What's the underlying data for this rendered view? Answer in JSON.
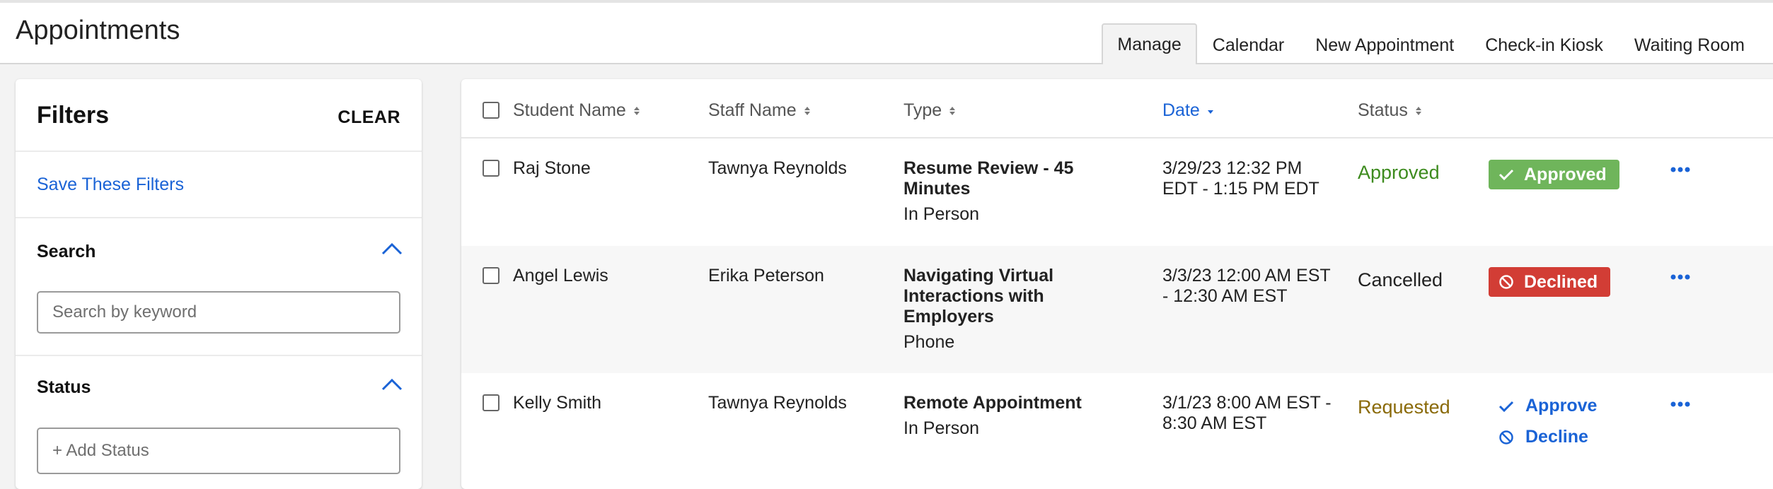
{
  "header": {
    "title": "Appointments",
    "tabs": [
      {
        "label": "Manage",
        "active": true
      },
      {
        "label": "Calendar"
      },
      {
        "label": "New Appointment"
      },
      {
        "label": "Check-in Kiosk"
      },
      {
        "label": "Waiting Room"
      }
    ]
  },
  "filters": {
    "title": "Filters",
    "clear_label": "CLEAR",
    "save_label": "Save These Filters",
    "search": {
      "title": "Search",
      "placeholder": "Search by keyword"
    },
    "status": {
      "title": "Status",
      "placeholder": "+ Add Status"
    }
  },
  "table": {
    "columns": {
      "student": "Student Name",
      "staff": "Staff Name",
      "type": "Type",
      "date": "Date",
      "status": "Status"
    },
    "sorted_column": "date",
    "rows": [
      {
        "student": "Raj Stone",
        "staff": "Tawnya Reynolds",
        "type_title": "Resume Review - 45 Minutes",
        "type_sub": "In Person",
        "date": "3/29/23 12:32 PM EDT - 1:15 PM EDT",
        "status": "Approved",
        "badge": "Approved"
      },
      {
        "student": "Angel Lewis",
        "staff": "Erika Peterson",
        "type_title": "Navigating Virtual Interactions with Employers",
        "type_sub": "Phone",
        "date": "3/3/23 12:00 AM EST - 12:30 AM EST",
        "status": "Cancelled",
        "badge": "Declined"
      },
      {
        "student": "Kelly Smith",
        "staff": "Tawnya Reynolds",
        "type_title": "Remote Appointment",
        "type_sub": "In Person",
        "date": "3/1/23 8:00 AM EST - 8:30 AM EST",
        "status": "Requested",
        "approve_label": "Approve",
        "decline_label": "Decline"
      }
    ]
  },
  "colors": {
    "link_blue": "#1a63d6",
    "approved_green": "#3d8b1e",
    "badge_green": "#6fb55b",
    "badge_red": "#d23d35",
    "requested_amber": "#8a6a09"
  },
  "icons": [
    "chevron-up-icon",
    "sort-icon",
    "sort-desc-icon",
    "check-icon",
    "ban-icon",
    "more-options-icon"
  ]
}
